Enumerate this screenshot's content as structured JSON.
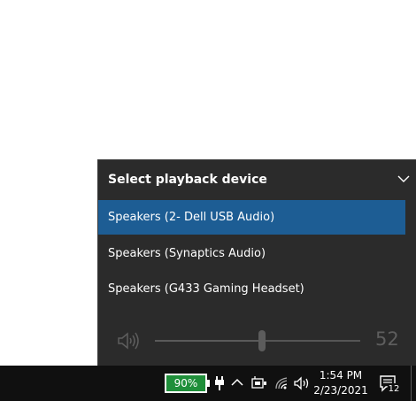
{
  "flyout": {
    "title": "Select playback device",
    "devices": [
      {
        "label": "Speakers (2- Dell USB Audio)",
        "selected": true
      },
      {
        "label": "Speakers (Synaptics Audio)",
        "selected": false
      },
      {
        "label": "Speakers (G433 Gaming Headset)",
        "selected": false
      }
    ],
    "volume": {
      "value": 52,
      "label": "52",
      "icon": "speaker-icon"
    }
  },
  "taskbar": {
    "battery": {
      "percent_label": "90%",
      "percent": 90,
      "color": "#1f8f3a"
    },
    "icons": [
      "power-plug-icon",
      "chevron-up-icon",
      "wifi-icon",
      "network-icon",
      "volume-icon",
      "notification-icon"
    ],
    "clock": {
      "time": "1:54 PM",
      "date": "2/23/2021"
    },
    "notification_count": "12"
  },
  "colors": {
    "selected": "#1d5d94",
    "flyout_bg": "#2b2b2b",
    "taskbar_bg": "#101010"
  }
}
